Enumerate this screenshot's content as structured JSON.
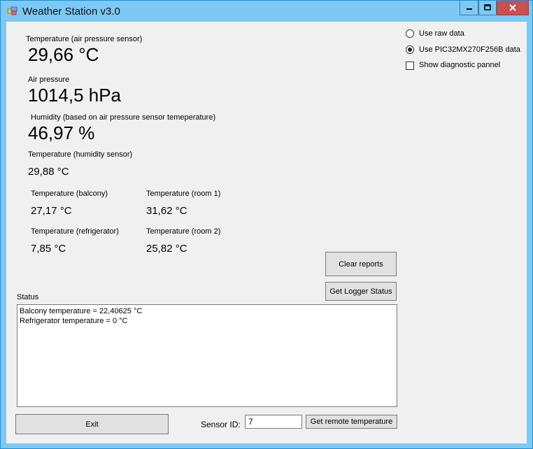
{
  "window": {
    "title": "Weather Station v3.0",
    "controls": {
      "minimize": "minimize-icon",
      "maximize": "maximize-icon",
      "close": "close-icon"
    }
  },
  "readings": {
    "temp_air_label": "Temperature (air pressure sensor)",
    "temp_air_value": "29,66 °C",
    "pressure_label": "Air pressure",
    "pressure_value": "1014,5 hPa",
    "humidity_label": "Humidity (based on air pressure sensor temeperature)",
    "humidity_value": "46,97 %",
    "temp_hum_label": "Temperature (humidity sensor)",
    "temp_hum_value": "29,88 °C",
    "balcony_label": "Temperature (balcony)",
    "balcony_value": "27,17 °C",
    "room1_label": "Temperature (room 1)",
    "room1_value": "31,62 °C",
    "fridge_label": "Temperature (refrigerator)",
    "fridge_value": "7,85 °C",
    "room2_label": "Temperature (room 2)",
    "room2_value": "25,82 °C"
  },
  "options": {
    "raw_label": "Use raw data",
    "raw_selected": false,
    "pic_label": "Use PIC32MX270F256B data",
    "pic_selected": true,
    "diag_label": "Show diagnostic pannel",
    "diag_checked": false
  },
  "buttons": {
    "clear": "Clear reports",
    "logger": "Get Logger Status",
    "exit": "Exit",
    "remote": "Get remote temperature"
  },
  "status": {
    "label": "Status",
    "lines": [
      "Balcony temperature = 22,40625 °C",
      "Refrigerator temperature = 0 °C"
    ]
  },
  "sensor": {
    "label": "Sensor ID:",
    "value": "7"
  }
}
